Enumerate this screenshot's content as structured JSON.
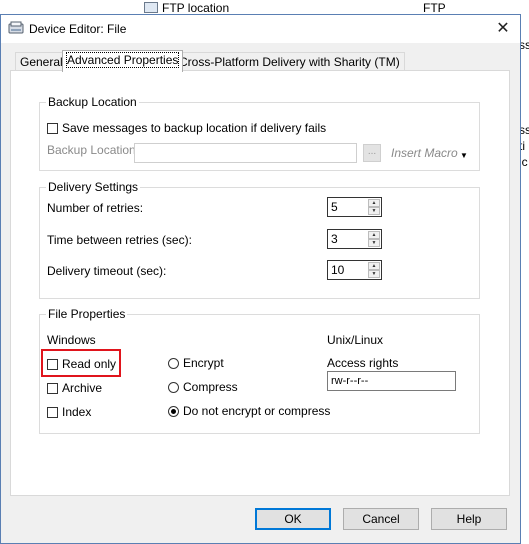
{
  "background": {
    "row": {
      "name": "FTP location",
      "type": "FTP"
    },
    "edge_fragments": [
      "ss",
      "ss",
      "ti",
      "ic",
      "c"
    ]
  },
  "dialog": {
    "title": "Device Editor: File",
    "close_glyph": "✕",
    "tabs": [
      {
        "label": "General"
      },
      {
        "label": "Advanced Properties"
      },
      {
        "label": "Cross-Platform Delivery with Sharity (TM)"
      }
    ],
    "backup": {
      "title": "Backup Location",
      "save_checkbox_label": "Save messages to backup location if delivery fails",
      "location_label": "Backup Location",
      "location_value": "",
      "browse_label": "...",
      "macro_label": "Insert Macro",
      "macro_arrow": "▼"
    },
    "delivery": {
      "title": "Delivery Settings",
      "retries_label": "Number of retries:",
      "retries_value": "5",
      "between_label": "Time between retries (sec):",
      "between_value": "3",
      "timeout_label": "Delivery timeout (sec):",
      "timeout_value": "10",
      "spin_up": "▲",
      "spin_down": "▼"
    },
    "file_props": {
      "title": "File Properties",
      "windows_label": "Windows",
      "read_only_label": "Read only",
      "archive_label": "Archive",
      "index_label": "Index",
      "encrypt_label": "Encrypt",
      "compress_label": "Compress",
      "none_label": "Do not encrypt or compress",
      "unix_label": "Unix/Linux",
      "access_label": "Access rights",
      "access_value": "rw-r--r--"
    },
    "buttons": {
      "ok": "OK",
      "cancel": "Cancel",
      "help": "Help"
    },
    "colors": {
      "highlight": "#e0141c",
      "default_button_border": "#0078d7",
      "title_border": "#5a7fb3"
    }
  }
}
